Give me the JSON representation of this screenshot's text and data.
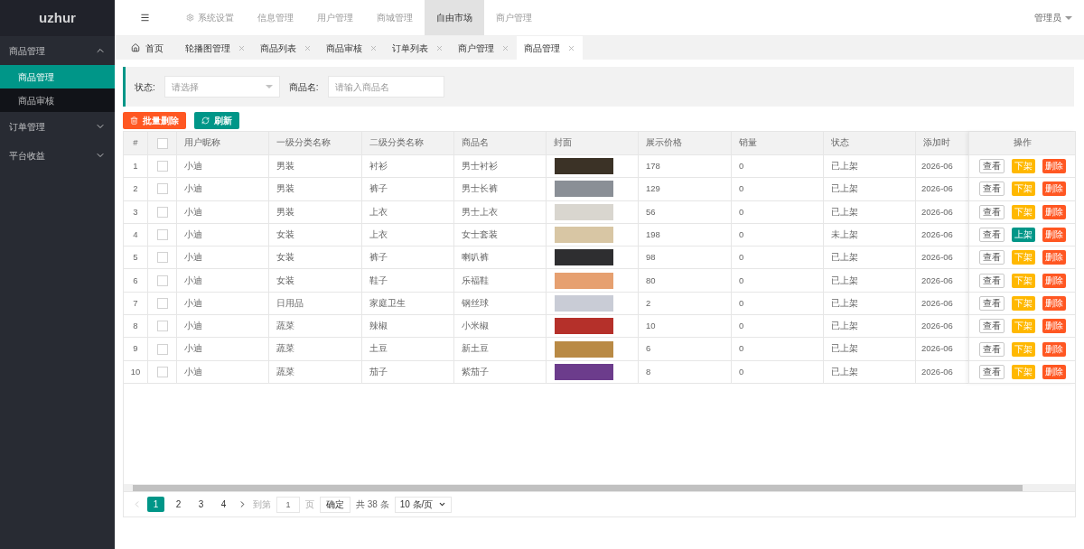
{
  "logo": "uzhur",
  "sidebar": [
    {
      "label": "商品管理",
      "expanded": true,
      "children": [
        {
          "label": "商品管理",
          "selected": true
        },
        {
          "label": "商品审核",
          "selected": false
        }
      ]
    },
    {
      "label": "订单管理",
      "expanded": false
    },
    {
      "label": "平台收益",
      "expanded": false
    }
  ],
  "top_nav": [
    {
      "label": "系统设置",
      "kind": "gear",
      "selected": false
    },
    {
      "label": "信息管理",
      "selected": false
    },
    {
      "label": "用户管理",
      "selected": false
    },
    {
      "label": "商城管理",
      "selected": false
    },
    {
      "label": "自由市场",
      "selected": true
    },
    {
      "label": "商户管理",
      "selected": false
    }
  ],
  "user": "管理员",
  "tabs": [
    {
      "label": "首页",
      "kind": "home",
      "selected": false
    },
    {
      "label": "轮播图管理",
      "selected": false
    },
    {
      "label": "商品列表",
      "selected": false
    },
    {
      "label": "商品审核",
      "selected": false
    },
    {
      "label": "订单列表",
      "selected": false
    },
    {
      "label": "商户管理",
      "selected": false
    },
    {
      "label": "商品管理",
      "selected": true
    }
  ],
  "filter": {
    "status_label": "状态:",
    "status_placeholder": "请选择",
    "name_label": "商品名:",
    "name_placeholder": "请输入商品名"
  },
  "toolbar": [
    {
      "label": "批量删除",
      "kind": "delete"
    },
    {
      "label": "刷新",
      "kind": "refresh"
    }
  ],
  "table": {
    "select_all_checked": false,
    "columns": [
      "#",
      "用户昵称",
      "一级分类名称",
      "二级分类名称",
      "商品名",
      "封面",
      "展示价格",
      "销量",
      "状态",
      "添加时",
      "操作"
    ],
    "rows": [
      {
        "n": "1",
        "checked": false,
        "user": "小迪",
        "cat1": "男装",
        "cat2": "衬衫",
        "name": "男士衬衫",
        "price": "178",
        "sales": "0",
        "status": "已上架",
        "time": "2026-06",
        "actions": [
          {
            "label": "查看",
            "kind": "view"
          },
          {
            "label": "下架",
            "kind": "off"
          },
          {
            "label": "删除",
            "kind": "delete"
          }
        ]
      },
      {
        "n": "2",
        "checked": false,
        "user": "小迪",
        "cat1": "男装",
        "cat2": "裤子",
        "name": "男士长裤",
        "price": "129",
        "sales": "0",
        "status": "已上架",
        "time": "2026-06",
        "actions": [
          {
            "label": "查看",
            "kind": "view"
          },
          {
            "label": "下架",
            "kind": "off"
          },
          {
            "label": "删除",
            "kind": "delete"
          }
        ]
      },
      {
        "n": "3",
        "checked": false,
        "user": "小迪",
        "cat1": "男装",
        "cat2": "上衣",
        "name": "男士上衣",
        "price": "56",
        "sales": "0",
        "status": "已上架",
        "time": "2026-06",
        "actions": [
          {
            "label": "查看",
            "kind": "view"
          },
          {
            "label": "下架",
            "kind": "off"
          },
          {
            "label": "删除",
            "kind": "delete"
          }
        ]
      },
      {
        "n": "4",
        "checked": false,
        "user": "小迪",
        "cat1": "女装",
        "cat2": "上衣",
        "name": "女士套装",
        "price": "198",
        "sales": "0",
        "status": "未上架",
        "time": "2026-06",
        "actions": [
          {
            "label": "查看",
            "kind": "view"
          },
          {
            "label": "上架",
            "kind": "on"
          },
          {
            "label": "删除",
            "kind": "delete"
          }
        ]
      },
      {
        "n": "5",
        "checked": false,
        "user": "小迪",
        "cat1": "女装",
        "cat2": "裤子",
        "name": "喇叭裤",
        "price": "98",
        "sales": "0",
        "status": "已上架",
        "time": "2026-06",
        "actions": [
          {
            "label": "查看",
            "kind": "view"
          },
          {
            "label": "下架",
            "kind": "off"
          },
          {
            "label": "删除",
            "kind": "delete"
          }
        ]
      },
      {
        "n": "6",
        "checked": false,
        "user": "小迪",
        "cat1": "女装",
        "cat2": "鞋子",
        "name": "乐福鞋",
        "price": "80",
        "sales": "0",
        "status": "已上架",
        "time": "2026-06",
        "actions": [
          {
            "label": "查看",
            "kind": "view"
          },
          {
            "label": "下架",
            "kind": "off"
          },
          {
            "label": "删除",
            "kind": "delete"
          }
        ]
      },
      {
        "n": "7",
        "checked": false,
        "user": "小迪",
        "cat1": "日用品",
        "cat2": "家庭卫生",
        "name": "钢丝球",
        "price": "2",
        "sales": "0",
        "status": "已上架",
        "time": "2026-06",
        "actions": [
          {
            "label": "查看",
            "kind": "view"
          },
          {
            "label": "下架",
            "kind": "off"
          },
          {
            "label": "删除",
            "kind": "delete"
          }
        ]
      },
      {
        "n": "8",
        "checked": false,
        "user": "小迪",
        "cat1": "蔬菜",
        "cat2": "辣椒",
        "name": "小米椒",
        "price": "10",
        "sales": "0",
        "status": "已上架",
        "time": "2026-06",
        "actions": [
          {
            "label": "查看",
            "kind": "view"
          },
          {
            "label": "下架",
            "kind": "off"
          },
          {
            "label": "删除",
            "kind": "delete"
          }
        ]
      },
      {
        "n": "9",
        "checked": false,
        "user": "小迪",
        "cat1": "蔬菜",
        "cat2": "土豆",
        "name": "新土豆",
        "price": "6",
        "sales": "0",
        "status": "已上架",
        "time": "2026-06",
        "actions": [
          {
            "label": "查看",
            "kind": "view"
          },
          {
            "label": "下架",
            "kind": "off"
          },
          {
            "label": "删除",
            "kind": "delete"
          }
        ]
      },
      {
        "n": "10",
        "checked": false,
        "user": "小迪",
        "cat1": "蔬菜",
        "cat2": "茄子",
        "name": "紫茄子",
        "price": "8",
        "sales": "0",
        "status": "已上架",
        "time": "2026-06",
        "actions": [
          {
            "label": "查看",
            "kind": "view"
          },
          {
            "label": "下架",
            "kind": "off"
          },
          {
            "label": "删除",
            "kind": "delete"
          }
        ]
      }
    ]
  },
  "pagination": {
    "pages": [
      {
        "label": "1",
        "selected": true
      },
      {
        "label": "2",
        "selected": false
      },
      {
        "label": "3",
        "selected": false
      },
      {
        "label": "4",
        "selected": false
      }
    ],
    "goto_label": "到第",
    "goto_value": "1",
    "page_label": "页",
    "confirm": "确定",
    "total": "共 38 条",
    "page_size": "10 条/页"
  }
}
